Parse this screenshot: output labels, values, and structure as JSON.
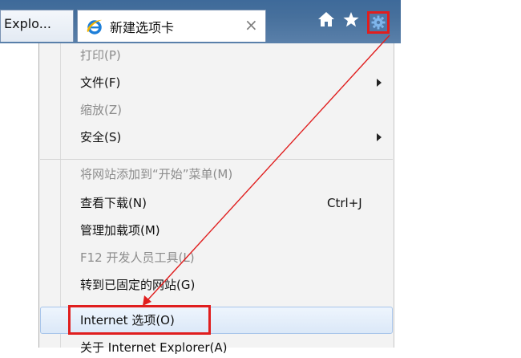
{
  "tabs": {
    "explorer_label": "Explo...",
    "active_label": "新建选项卡",
    "close_symbol": "×"
  },
  "toolbar": {
    "home_icon": "home-icon",
    "favorites_icon": "star-icon",
    "tools_icon": "gear-icon"
  },
  "menu": {
    "items": [
      {
        "label": "打印(P)",
        "enabled": false
      },
      {
        "label": "文件(F)",
        "enabled": true,
        "submenu": true
      },
      {
        "label": "缩放(Z)",
        "enabled": false
      },
      {
        "label": "安全(S)",
        "enabled": true,
        "submenu": true
      },
      {
        "label": "将网站添加到“开始”菜单(M)",
        "enabled": false
      },
      {
        "label": "查看下载(N)",
        "enabled": true,
        "shortcut": "Ctrl+J"
      },
      {
        "label": "管理加载项(M)",
        "enabled": true
      },
      {
        "label": "F12 开发人员工具(L)",
        "enabled": false
      },
      {
        "label": "转到已固定的网站(G)",
        "enabled": true
      },
      {
        "label": "Internet 选项(O)",
        "enabled": true,
        "highlighted": true
      },
      {
        "label": "关于 Internet Explorer(A)",
        "enabled": true
      }
    ]
  },
  "colors": {
    "annotation_red": "#e01e1e",
    "chrome_blue": "#47709c",
    "menu_bg": "#f3f3f3",
    "highlight_blue": "#dbe8f8"
  }
}
